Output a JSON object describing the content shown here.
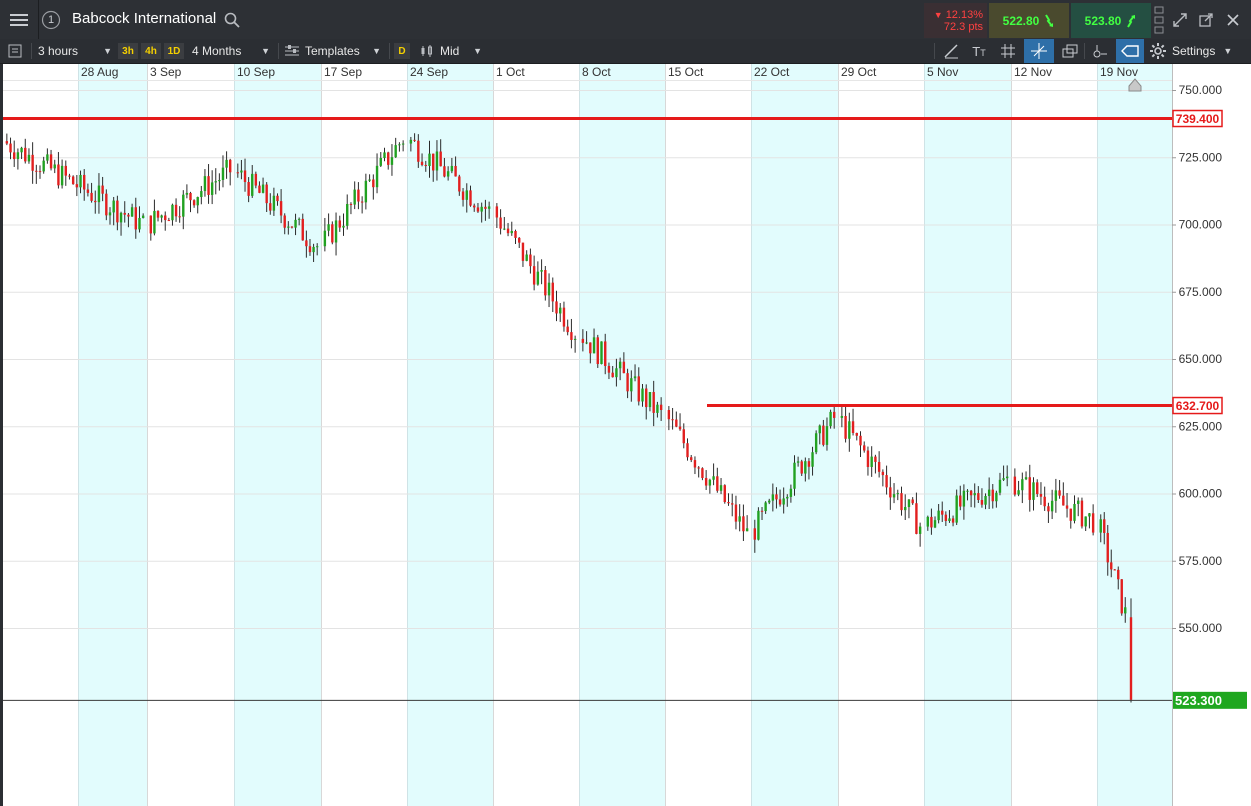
{
  "window": {
    "title": "Babcock International",
    "link_number": "1",
    "change_pct": "12.13%",
    "change_pts": "72.3 pts",
    "sell_price": "522.80",
    "buy_price": "523.80"
  },
  "toolbar": {
    "interval": "3 hours",
    "quick_3h": "3h",
    "quick_4h": "4h",
    "quick_1d": "1D",
    "range": "4 Months",
    "templates": "Templates",
    "d_badge": "D",
    "price_type": "Mid",
    "settings": "Settings",
    "text_tool": "T",
    "text_tool_sub": "T"
  },
  "colors": {
    "up": "#21a121",
    "down": "#e21f1f",
    "weekend_band": "#e2fcfd",
    "line_red": "#e51a1a",
    "last_price_bg": "#1fa71f",
    "background": "#ffffff"
  },
  "chart_data": {
    "type": "candlestick",
    "x_tick_labels": [
      "28 Aug",
      "3 Sep",
      "10 Sep",
      "17 Sep",
      "24 Sep",
      "1 Oct",
      "8 Oct",
      "15 Oct",
      "22 Oct",
      "29 Oct",
      "5 Nov",
      "12 Nov",
      "19 Nov"
    ],
    "y_tick_labels": [
      "750.000",
      "725.000",
      "700.000",
      "675.000",
      "650.000",
      "625.000",
      "600.000",
      "575.000",
      "550.000"
    ],
    "y_ticks": [
      750,
      725,
      700,
      675,
      650,
      625,
      600,
      575,
      550
    ],
    "ylim": [
      505,
      757
    ],
    "horizontal_lines": [
      {
        "value": 739.4,
        "label": "739.400"
      },
      {
        "value": 632.7,
        "label": "632.700"
      }
    ],
    "last_price": {
      "value": 523.3,
      "label": "523.300"
    },
    "weeks": [
      {
        "label": "28 Aug",
        "start": 731,
        "end": 700
      },
      {
        "label": "3 Sep",
        "start": 700,
        "end": 720
      },
      {
        "label": "10 Sep",
        "start": 720,
        "end": 692
      },
      {
        "label": "17 Sep",
        "start": 692,
        "end": 732
      },
      {
        "label": "24 Sep",
        "start": 732,
        "end": 705
      },
      {
        "label": "1 Oct",
        "start": 705,
        "end": 660
      },
      {
        "label": "8 Oct",
        "start": 660,
        "end": 629
      },
      {
        "label": "15 Oct",
        "start": 629,
        "end": 585
      },
      {
        "label": "22 Oct",
        "start": 585,
        "end": 628
      },
      {
        "label": "29 Oct",
        "start": 628,
        "end": 588
      },
      {
        "label": "5 Nov",
        "start": 588,
        "end": 605
      },
      {
        "label": "12 Nov",
        "start": 605,
        "end": 590
      },
      {
        "label": "19 Nov",
        "start": 590,
        "end": 555
      }
    ]
  }
}
